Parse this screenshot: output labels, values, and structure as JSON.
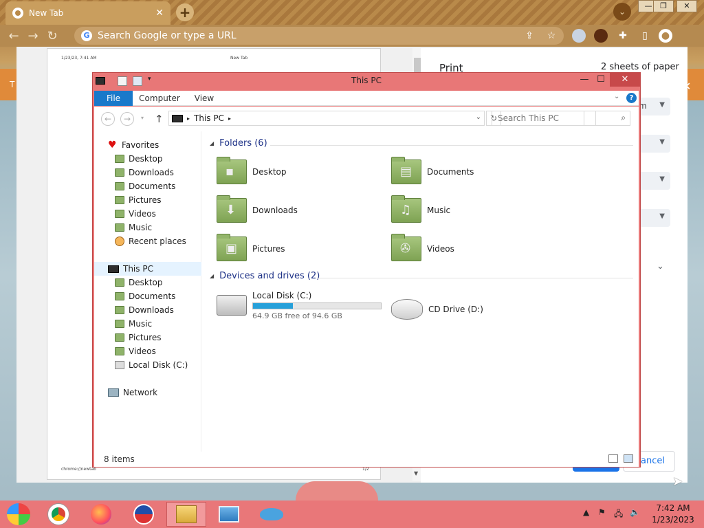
{
  "chrome": {
    "tab_title": "New Tab",
    "tab_close": "✕",
    "new_tab": "+",
    "omnibox_placeholder": "Search Google or type a URL",
    "profile_chip": "⌄",
    "win_min": "—",
    "win_max": "❐",
    "win_close": "✕",
    "partial_left": "T",
    "partial_close": "✕"
  },
  "print_preview": {
    "header_datetime": "1/23/23, 7:41 AM",
    "header_title": "New Tab",
    "footer_url": "chrome://newtab",
    "footer_page": "1/2",
    "panel_title": "Print",
    "sheets": "2 sheets of paper",
    "select_partial": "m",
    "cancel_label": "Cancel"
  },
  "explorer": {
    "title": "This PC",
    "ribbon_tabs": [
      "File",
      "Computer",
      "View"
    ],
    "help": "?",
    "breadcrumb": "This PC",
    "search_placeholder": "Search This PC",
    "nav": {
      "favorites_label": "Favorites",
      "favorites": [
        "Desktop",
        "Downloads",
        "Documents",
        "Pictures",
        "Videos",
        "Music",
        "Recent places"
      ],
      "thispc_label": "This PC",
      "thispc": [
        "Desktop",
        "Documents",
        "Downloads",
        "Music",
        "Pictures",
        "Videos",
        "Local Disk (C:)"
      ],
      "network_label": "Network"
    },
    "folders_header": "Folders (6)",
    "folders": [
      "Desktop",
      "Documents",
      "Downloads",
      "Music",
      "Pictures",
      "Videos"
    ],
    "devices_header": "Devices and drives (2)",
    "drives": {
      "c_name": "Local Disk (C:)",
      "c_free": "64.9 GB free of 94.6 GB",
      "c_used_fraction": 0.314,
      "d_name": "CD Drive (D:)"
    },
    "status_items": "8 items"
  },
  "taskbar": {
    "time": "7:42 AM",
    "date": "1/23/2023"
  }
}
